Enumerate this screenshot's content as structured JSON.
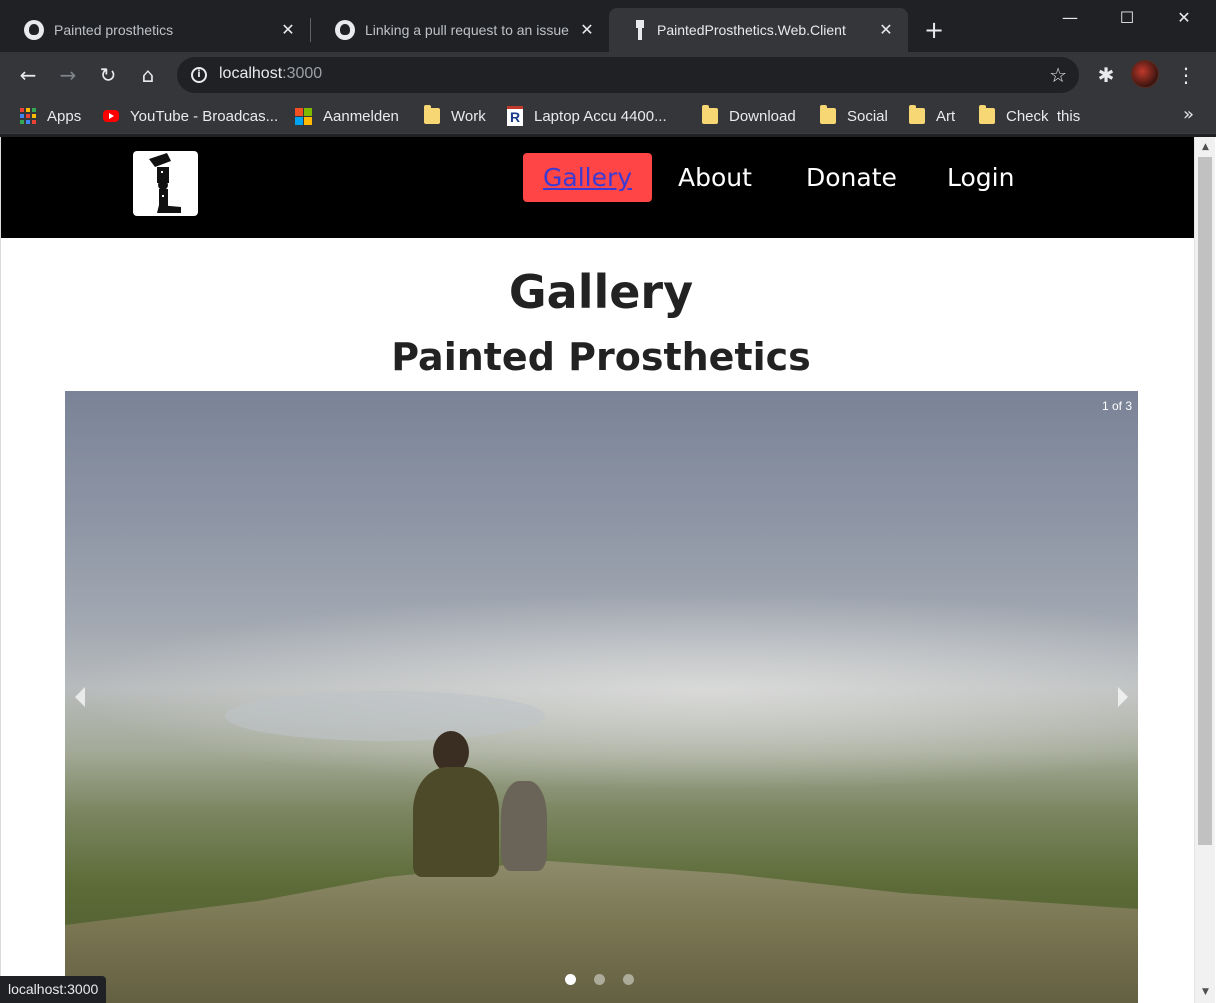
{
  "browser": {
    "tabs": [
      {
        "title": "Painted prosthetics",
        "icon": "github-icon"
      },
      {
        "title": "Linking a pull request to an issue",
        "icon": "github-icon"
      },
      {
        "title": "PaintedProsthetics.Web.Client",
        "icon": "prosthetic-leg-icon",
        "active": true
      }
    ],
    "address": {
      "host": "localhost",
      "port": ":3000"
    },
    "bookmarks": [
      {
        "label": "Apps",
        "icon": "apps-grid-icon"
      },
      {
        "label": "YouTube - Broadcas...",
        "icon": "youtube-icon"
      },
      {
        "label": "Aanmelden",
        "icon": "microsoft-icon"
      },
      {
        "label": "Work",
        "icon": "folder-icon"
      },
      {
        "label": "Laptop Accu 4400...",
        "icon": "r-logo-icon"
      },
      {
        "label": "Download",
        "icon": "folder-icon"
      },
      {
        "label": "Social",
        "icon": "folder-icon"
      },
      {
        "label": "Art",
        "icon": "folder-icon"
      },
      {
        "label": "Check  this",
        "icon": "folder-icon"
      }
    ],
    "bookmarks_more": "»",
    "status_url": "localhost:3000"
  },
  "site": {
    "nav": [
      {
        "label": "Gallery",
        "active": true
      },
      {
        "label": "About"
      },
      {
        "label": "Donate"
      },
      {
        "label": "Login"
      }
    ],
    "heading": "Gallery",
    "subheading": "Painted Prosthetics",
    "carousel": {
      "counter": "1 of 3",
      "slide_count": 3,
      "active_slide": 1
    }
  },
  "colors": {
    "nav_active_bg": "#ff4545",
    "header_bg": "#000000",
    "chrome_bg": "#202124",
    "toolbar_bg": "#35363a"
  }
}
